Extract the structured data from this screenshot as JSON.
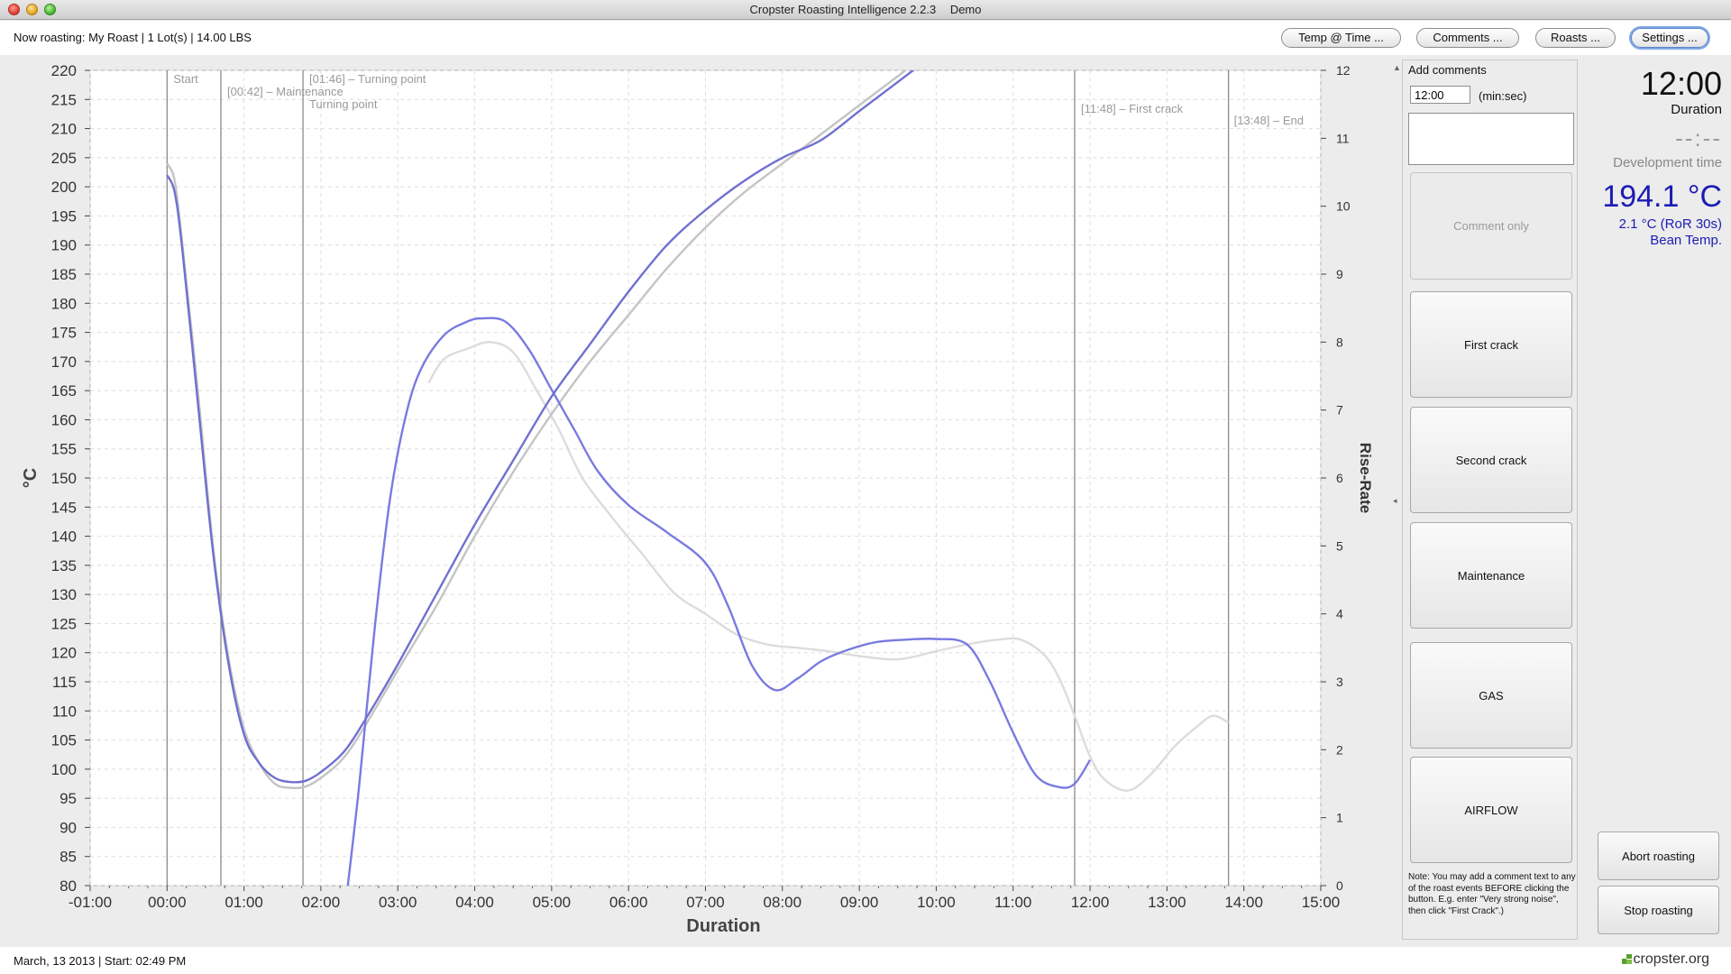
{
  "window": {
    "title": "Cropster Roasting Intelligence 2.2.3",
    "mode": "Demo"
  },
  "header": {
    "now_roasting": "Now roasting: My Roast | 1 Lot(s) | 14.00 LBS",
    "buttons": {
      "temp_at_time": "Temp @ Time ...",
      "comments": "Comments ...",
      "roasts": "Roasts ...",
      "settings": "Settings ..."
    }
  },
  "chart_data": {
    "type": "line",
    "xlabel": "Duration",
    "ylabel": "°C",
    "y2label": "Rise-Rate",
    "x_ticks": [
      "-01:00",
      "00:00",
      "01:00",
      "02:00",
      "03:00",
      "04:00",
      "05:00",
      "06:00",
      "07:00",
      "08:00",
      "09:00",
      "10:00",
      "11:00",
      "12:00",
      "13:00",
      "14:00",
      "15:00"
    ],
    "xlim_min": [
      -1,
      15
    ],
    "ylim": [
      80,
      220
    ],
    "y_ticks": [
      80,
      85,
      90,
      95,
      100,
      105,
      110,
      115,
      120,
      125,
      130,
      135,
      140,
      145,
      150,
      155,
      160,
      165,
      170,
      175,
      180,
      185,
      190,
      195,
      200,
      205,
      210,
      215,
      220
    ],
    "y2lim": [
      0,
      12
    ],
    "y2_ticks": [
      0,
      1,
      2,
      3,
      4,
      5,
      6,
      7,
      8,
      9,
      10,
      11,
      12
    ],
    "grid": true,
    "events": [
      {
        "t": 0.0,
        "label": "Start"
      },
      {
        "t": 0.7,
        "label": "[00:42] – Maintenance"
      },
      {
        "t": 1.767,
        "label": "Turning point"
      },
      {
        "t": 1.767,
        "label": "[01:46] – Turning point"
      },
      {
        "t": 11.8,
        "label": "[11:48] – First crack"
      },
      {
        "t": 13.8,
        "label": "[13:48] – End"
      }
    ],
    "series": [
      {
        "role": "current bean temperature",
        "axis": "left",
        "color": "#7070d0",
        "x": [
          0,
          0.1,
          0.2,
          0.4,
          0.6,
          0.8,
          1.0,
          1.2,
          1.4,
          1.6,
          1.8,
          2.0,
          2.3,
          2.6,
          3.0,
          3.5,
          4.0,
          4.5,
          5.0,
          5.5,
          6.0,
          6.5,
          7.0,
          7.5,
          8.0,
          8.5,
          9.0,
          9.5,
          10.0,
          10.5,
          11.0,
          11.5,
          12.0
        ],
        "y": [
          202,
          199,
          189,
          163,
          137,
          118,
          106,
          101,
          98.5,
          97.8,
          98,
          99.5,
          103,
          109,
          118,
          130,
          142,
          153,
          164,
          173,
          182,
          190,
          196,
          201,
          205,
          208,
          213,
          218,
          223,
          228,
          232,
          235,
          239
        ]
      },
      {
        "role": "reference bean temperature",
        "axis": "left",
        "color": "#c4c4c4",
        "x": [
          0,
          0.1,
          0.2,
          0.4,
          0.6,
          0.8,
          1.0,
          1.2,
          1.4,
          1.6,
          1.8,
          2.0,
          2.3,
          2.6,
          3.0,
          3.5,
          4.0,
          4.5,
          5.0,
          5.5,
          6.0,
          6.5,
          7.0,
          7.5,
          8.0,
          8.5,
          9.0,
          9.5,
          10.0,
          10.5,
          11.0,
          11.5,
          12.0,
          12.5,
          13.0,
          13.5,
          13.85
        ],
        "y": [
          204,
          201,
          190,
          165,
          138,
          119,
          107,
          101,
          97.5,
          96.8,
          97,
          98.5,
          102,
          108,
          117,
          128,
          140,
          151,
          161,
          170,
          178,
          186,
          193,
          199,
          204,
          209,
          214,
          219,
          224,
          228,
          233,
          236,
          239,
          241,
          244,
          247,
          248
        ]
      },
      {
        "role": "current rate of rise",
        "axis": "right",
        "color": "#7a7ae0",
        "x": [
          2.35,
          2.5,
          2.7,
          2.9,
          3.1,
          3.3,
          3.6,
          3.9,
          4.1,
          4.4,
          4.7,
          5.0,
          5.3,
          5.6,
          6.0,
          6.5,
          7.0,
          7.3,
          7.6,
          7.9,
          8.2,
          8.5,
          8.8,
          9.2,
          9.6,
          10.0,
          10.4,
          10.7,
          11.0,
          11.3,
          11.6,
          11.8,
          12.0
        ],
        "y": [
          0,
          1.5,
          3.8,
          5.7,
          6.9,
          7.6,
          8.1,
          8.3,
          8.35,
          8.3,
          7.9,
          7.3,
          6.7,
          6.1,
          5.6,
          5.2,
          4.75,
          4.1,
          3.25,
          2.88,
          3.05,
          3.3,
          3.45,
          3.58,
          3.62,
          3.63,
          3.55,
          3.0,
          2.25,
          1.62,
          1.45,
          1.5,
          1.85
        ]
      },
      {
        "role": "reference rate of rise",
        "axis": "right",
        "color": "#dcdcdc",
        "x": [
          3.4,
          3.6,
          3.9,
          4.2,
          4.5,
          4.8,
          5.1,
          5.4,
          5.8,
          6.2,
          6.6,
          7.0,
          7.4,
          7.8,
          8.2,
          8.6,
          9.0,
          9.5,
          10.0,
          10.4,
          10.8,
          11.1,
          11.4,
          11.6,
          11.8,
          12.0,
          12.2,
          12.5,
          12.8,
          13.1,
          13.4,
          13.6,
          13.8
        ],
        "y": [
          7.4,
          7.75,
          7.9,
          8.0,
          7.85,
          7.3,
          6.7,
          6.0,
          5.4,
          4.85,
          4.3,
          4.0,
          3.7,
          3.55,
          3.5,
          3.45,
          3.38,
          3.33,
          3.45,
          3.55,
          3.62,
          3.62,
          3.4,
          3.05,
          2.5,
          1.9,
          1.55,
          1.4,
          1.65,
          2.05,
          2.35,
          2.5,
          2.4
        ]
      }
    ]
  },
  "comments_panel": {
    "title": "Add comments",
    "time_value": "12:00",
    "time_unit": "(min:sec)",
    "buttons": [
      "Comment only",
      "First crack",
      "Second crack",
      "Maintenance",
      "GAS",
      "AIRFLOW"
    ],
    "note": "Note: You may add a comment text to any of the roast events BEFORE clicking the button. E.g. enter \"Very strong noise\", then click \"First Crack\".)"
  },
  "status": {
    "duration_value": "12:00",
    "duration_label": "Duration",
    "development_value": "--:--",
    "development_label": "Development time",
    "temperature_value": "194.1 °C",
    "ror_value": "2.1 °C (RoR 30s)",
    "probe_label": "Bean Temp.",
    "temp_color": "#1c1cb4"
  },
  "actions": {
    "abort": "Abort roasting",
    "stop": "Stop roasting"
  },
  "footer": {
    "date_start": "March, 13 2013 | Start: 02:49 PM",
    "logo": "cropster.org"
  }
}
